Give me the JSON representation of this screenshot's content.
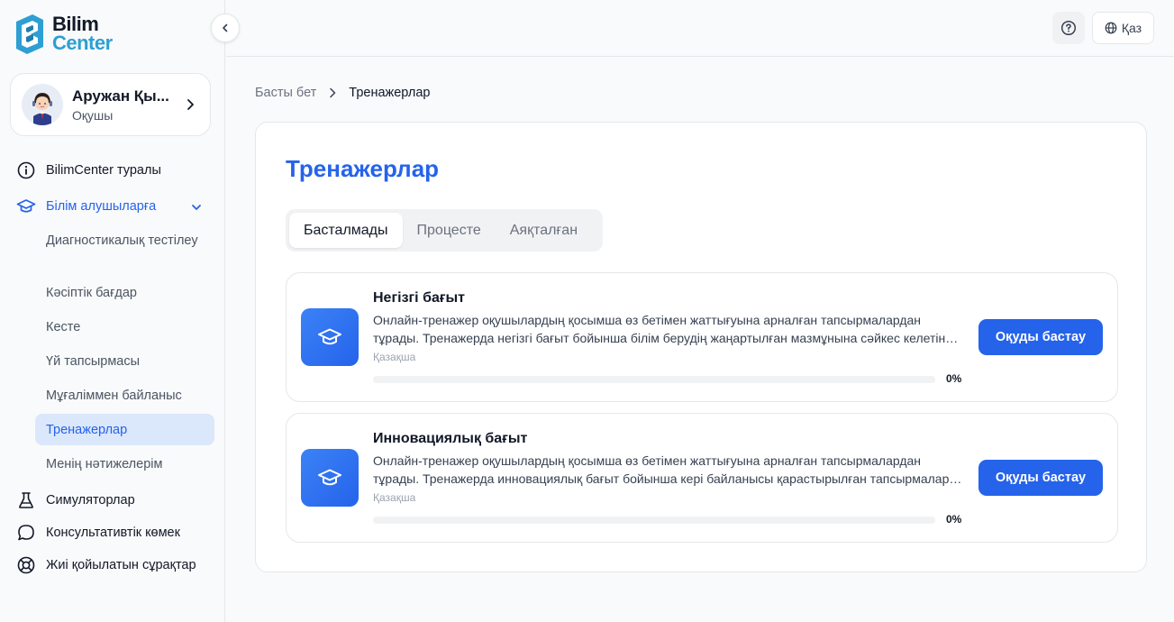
{
  "brand": {
    "line1": "Bilim",
    "line2": "Center",
    "accent": "#2d9fd3"
  },
  "colors": {
    "primary": "#2563eb",
    "active_bg": "#dbe7fb"
  },
  "header": {
    "help_icon": "help-circle-icon",
    "language": "Қаз",
    "language_icon": "globe-icon"
  },
  "user": {
    "name": "Аружан Қы...",
    "role": "Оқушы"
  },
  "sidebar": {
    "items": [
      {
        "label": "BilimCenter туралы",
        "icon": "info-icon"
      },
      {
        "label": "Білім алушыларға",
        "icon": "graduation-cap-icon",
        "expanded": true
      },
      {
        "label": "Симуляторлар",
        "icon": "flask-icon"
      },
      {
        "label": "Консультативтік көмек",
        "icon": "chat-icon"
      },
      {
        "label": "Жиі қойылатын сұрақтар",
        "icon": "lifebuoy-icon"
      }
    ],
    "subitems": [
      {
        "label": "Диагностикалық тестілеу"
      },
      {
        "label": "Кәсіптік бағдар"
      },
      {
        "label": "Кесте"
      },
      {
        "label": "Үй тапсырмасы"
      },
      {
        "label": "Мұғаліммен байланыс"
      },
      {
        "label": "Тренажерлар"
      },
      {
        "label": "Менің нәтижелерім"
      }
    ]
  },
  "breadcrumb": {
    "home": "Басты бет",
    "current": "Тренажерлар"
  },
  "main": {
    "title": "Тренажерлар",
    "tabs": [
      {
        "label": "Басталмады",
        "active": true
      },
      {
        "label": "Процесте"
      },
      {
        "label": "Аяқталған"
      }
    ],
    "courses": [
      {
        "title": "Негізгі бағыт",
        "description": "Онлайн-тренажер оқушылардың қосымша өз бетімен жаттығуына арналған тапсырмалардан тұрады. Тренажерда негізгі бағыт бойынша білім берудің жаңартылған мазмұнына сәйкес келетін тапсырмалар берілген.",
        "language": "Қазақша",
        "progress_label": "0%",
        "progress": 0,
        "button": "Оқуды бастау",
        "icon": "graduation-cap-icon"
      },
      {
        "title": "Инновациялық бағыт",
        "description": "Онлайн-тренажер оқушылардың қосымша өз бетімен жаттығуына арналған тапсырмалардан тұрады. Тренажерда инновациялық бағыт бойынша кері байланысы қарастырылған тапсырмалар берілген.",
        "language": "Қазақша",
        "progress_label": "0%",
        "progress": 0,
        "button": "Оқуды бастау",
        "icon": "graduation-cap-icon"
      }
    ]
  }
}
